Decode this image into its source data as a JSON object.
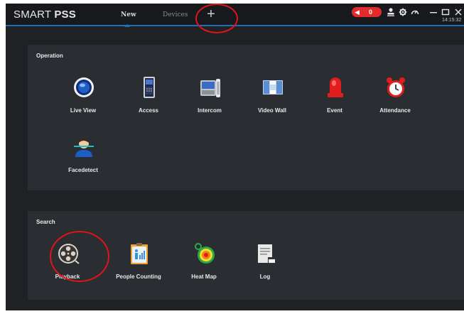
{
  "app": {
    "logo_prefix": "SMART",
    "logo_suffix": "PSS"
  },
  "tabs": [
    {
      "label": "New",
      "active": true
    },
    {
      "label": "Devices",
      "active": false
    }
  ],
  "add_tab_label": "+",
  "alarm": {
    "count": "0",
    "color": "#e32b2b"
  },
  "clock": "14:15:32",
  "accent_color": "#1d6fb8",
  "operation": {
    "title": "Operation",
    "items": [
      {
        "label": "Live View",
        "icon": "live-view-icon"
      },
      {
        "label": "Access",
        "icon": "access-icon"
      },
      {
        "label": "Intercom",
        "icon": "intercom-icon"
      },
      {
        "label": "Video Wall",
        "icon": "video-wall-icon"
      },
      {
        "label": "Event",
        "icon": "event-icon"
      },
      {
        "label": "Attendance",
        "icon": "attendance-icon"
      },
      {
        "label": "Facedetect",
        "icon": "facedetect-icon"
      }
    ]
  },
  "search": {
    "title": "Search",
    "items": [
      {
        "label": "Playback",
        "icon": "playback-icon"
      },
      {
        "label": "People Counting",
        "icon": "people-counting-icon"
      },
      {
        "label": "Heat Map",
        "icon": "heat-map-icon"
      },
      {
        "label": "Log",
        "icon": "log-icon"
      }
    ]
  }
}
